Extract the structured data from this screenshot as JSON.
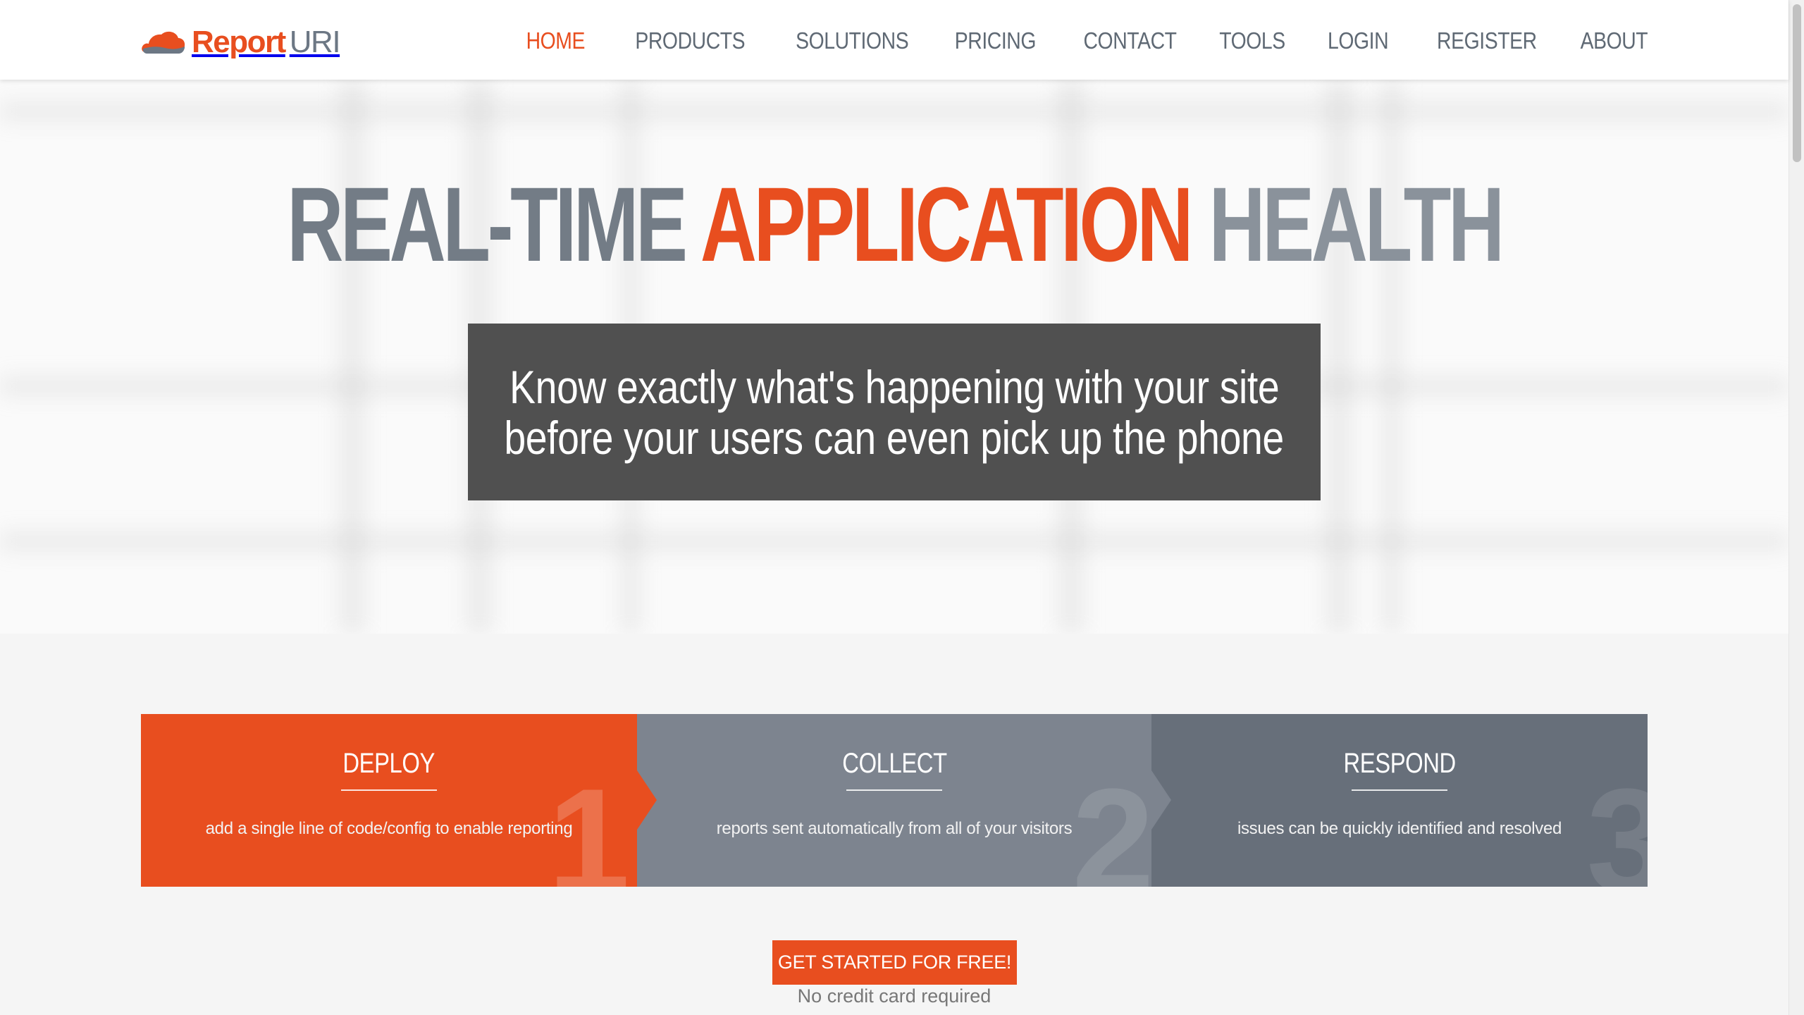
{
  "brand": {
    "name_part1": "Report",
    "name_part2": "URI",
    "accent_color": "#e84e1f",
    "text_color": "#6c7784"
  },
  "nav": {
    "items": [
      {
        "label": "HOME",
        "active": true
      },
      {
        "label": "PRODUCTS",
        "active": false
      },
      {
        "label": "SOLUTIONS",
        "active": false
      },
      {
        "label": "PRICING",
        "active": false
      },
      {
        "label": "CONTACT",
        "active": false
      },
      {
        "label": "TOOLS",
        "active": false
      },
      {
        "label": "LOGIN",
        "active": false
      },
      {
        "label": "REGISTER",
        "active": false
      },
      {
        "label": "ABOUT",
        "active": false
      }
    ]
  },
  "hero": {
    "title_part1": "REAL-TIME ",
    "title_part2": "APPLICATION",
    "title_part3": " HEALTH",
    "tagline_line1": "Know exactly what's happening with your site",
    "tagline_line2": "before your users can even pick up the phone"
  },
  "steps": [
    {
      "title": "DEPLOY",
      "description": "add a single line of code/config to enable reporting",
      "number": "1",
      "color": "#e84e1f"
    },
    {
      "title": "COLLECT",
      "description": "reports sent automatically from all of your visitors",
      "number": "2",
      "color": "#7d848f"
    },
    {
      "title": "RESPOND",
      "description": "issues can be quickly identified and resolved",
      "number": "3",
      "color": "#676f7a"
    }
  ],
  "cta": {
    "button_label": "GET STARTED FOR FREE!",
    "note": "No credit card required"
  },
  "icons": {
    "logo": "cloud-icon"
  }
}
